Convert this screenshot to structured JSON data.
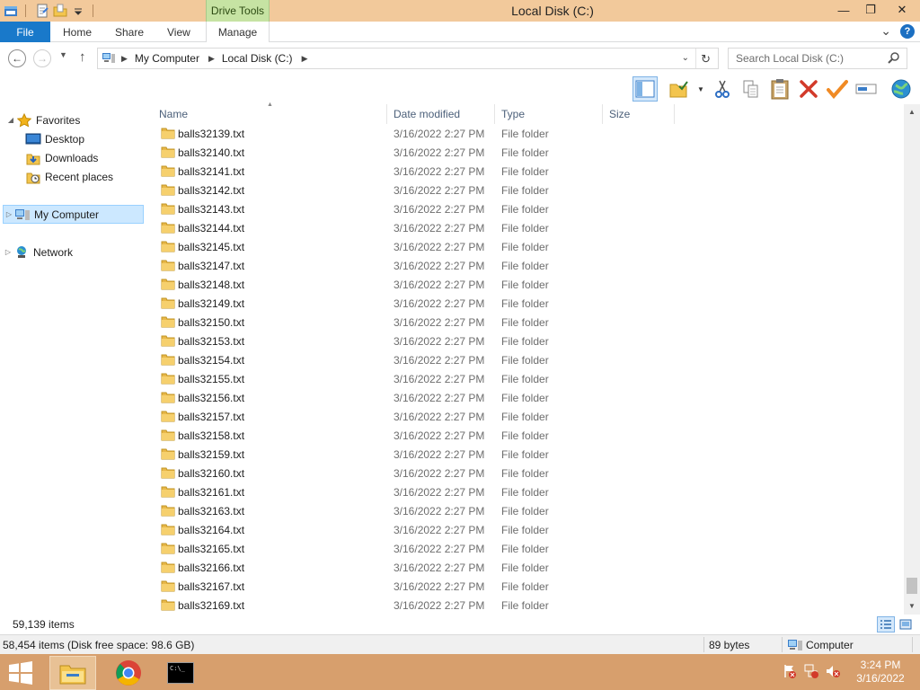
{
  "window": {
    "title": "Local Disk (C:)",
    "context_tab_group": "Drive Tools",
    "controls": {
      "minimize": "—",
      "restore": "❐",
      "close": "✕"
    }
  },
  "ribbon": {
    "tabs": [
      "File",
      "Home",
      "Share",
      "View",
      "Manage"
    ],
    "expand_glyph": "⌄",
    "help_glyph": "?"
  },
  "address": {
    "back_glyph": "←",
    "forward_glyph": "→",
    "history_glyph": "▼",
    "up_glyph": "↑",
    "crumbs": [
      "My Computer",
      "Local Disk (C:)"
    ],
    "crumb_separator": "▶",
    "dropdown_glyph": "⌄",
    "refresh_glyph": "↻",
    "search_placeholder": "Search Local Disk (C:)"
  },
  "navpane": {
    "favorites": {
      "label": "Favorites",
      "expander": "◢"
    },
    "items": [
      {
        "label": "Desktop",
        "icon": "desktop-icon"
      },
      {
        "label": "Downloads",
        "icon": "downloads-icon"
      },
      {
        "label": "Recent places",
        "icon": "recent-places-icon"
      }
    ],
    "computer": {
      "label": "My Computer",
      "expander": "▷",
      "selected": true
    },
    "network": {
      "label": "Network",
      "expander": "▷"
    }
  },
  "filelist": {
    "columns": [
      "Name",
      "Date modified",
      "Type",
      "Size"
    ],
    "sort_glyph": "▲",
    "rows": [
      {
        "name": "balls32139.txt",
        "date": "3/16/2022 2:27 PM",
        "type": "File folder",
        "size": ""
      },
      {
        "name": "balls32140.txt",
        "date": "3/16/2022 2:27 PM",
        "type": "File folder",
        "size": ""
      },
      {
        "name": "balls32141.txt",
        "date": "3/16/2022 2:27 PM",
        "type": "File folder",
        "size": ""
      },
      {
        "name": "balls32142.txt",
        "date": "3/16/2022 2:27 PM",
        "type": "File folder",
        "size": ""
      },
      {
        "name": "balls32143.txt",
        "date": "3/16/2022 2:27 PM",
        "type": "File folder",
        "size": ""
      },
      {
        "name": "balls32144.txt",
        "date": "3/16/2022 2:27 PM",
        "type": "File folder",
        "size": ""
      },
      {
        "name": "balls32145.txt",
        "date": "3/16/2022 2:27 PM",
        "type": "File folder",
        "size": ""
      },
      {
        "name": "balls32147.txt",
        "date": "3/16/2022 2:27 PM",
        "type": "File folder",
        "size": ""
      },
      {
        "name": "balls32148.txt",
        "date": "3/16/2022 2:27 PM",
        "type": "File folder",
        "size": ""
      },
      {
        "name": "balls32149.txt",
        "date": "3/16/2022 2:27 PM",
        "type": "File folder",
        "size": ""
      },
      {
        "name": "balls32150.txt",
        "date": "3/16/2022 2:27 PM",
        "type": "File folder",
        "size": ""
      },
      {
        "name": "balls32153.txt",
        "date": "3/16/2022 2:27 PM",
        "type": "File folder",
        "size": ""
      },
      {
        "name": "balls32154.txt",
        "date": "3/16/2022 2:27 PM",
        "type": "File folder",
        "size": ""
      },
      {
        "name": "balls32155.txt",
        "date": "3/16/2022 2:27 PM",
        "type": "File folder",
        "size": ""
      },
      {
        "name": "balls32156.txt",
        "date": "3/16/2022 2:27 PM",
        "type": "File folder",
        "size": ""
      },
      {
        "name": "balls32157.txt",
        "date": "3/16/2022 2:27 PM",
        "type": "File folder",
        "size": ""
      },
      {
        "name": "balls32158.txt",
        "date": "3/16/2022 2:27 PM",
        "type": "File folder",
        "size": ""
      },
      {
        "name": "balls32159.txt",
        "date": "3/16/2022 2:27 PM",
        "type": "File folder",
        "size": ""
      },
      {
        "name": "balls32160.txt",
        "date": "3/16/2022 2:27 PM",
        "type": "File folder",
        "size": ""
      },
      {
        "name": "balls32161.txt",
        "date": "3/16/2022 2:27 PM",
        "type": "File folder",
        "size": ""
      },
      {
        "name": "balls32163.txt",
        "date": "3/16/2022 2:27 PM",
        "type": "File folder",
        "size": ""
      },
      {
        "name": "balls32164.txt",
        "date": "3/16/2022 2:27 PM",
        "type": "File folder",
        "size": ""
      },
      {
        "name": "balls32165.txt",
        "date": "3/16/2022 2:27 PM",
        "type": "File folder",
        "size": ""
      },
      {
        "name": "balls32166.txt",
        "date": "3/16/2022 2:27 PM",
        "type": "File folder",
        "size": ""
      },
      {
        "name": "balls32167.txt",
        "date": "3/16/2022 2:27 PM",
        "type": "File folder",
        "size": ""
      },
      {
        "name": "balls32169.txt",
        "date": "3/16/2022 2:27 PM",
        "type": "File folder",
        "size": ""
      }
    ]
  },
  "scrollbar": {
    "up_glyph": "▲",
    "down_glyph": "▼"
  },
  "status": {
    "item_count": "59,139 items"
  },
  "details": {
    "selection": "58,454 items (Disk free space: 98.6 GB)",
    "size": "89 bytes",
    "location": "Computer"
  },
  "taskbar": {
    "apps": [
      "file-explorer",
      "chrome",
      "command-prompt"
    ],
    "cmd_label": "C:\\_",
    "clock_time": "3:24 PM",
    "clock_date": "3/16/2022"
  },
  "colors": {
    "titlebar": "#f2c99b",
    "drive_tools": "#c6e3a3",
    "file_tab": "#1979ca",
    "taskbar": "#d79f6d",
    "folder": "#e8b84a",
    "selection": "#cce8ff"
  }
}
